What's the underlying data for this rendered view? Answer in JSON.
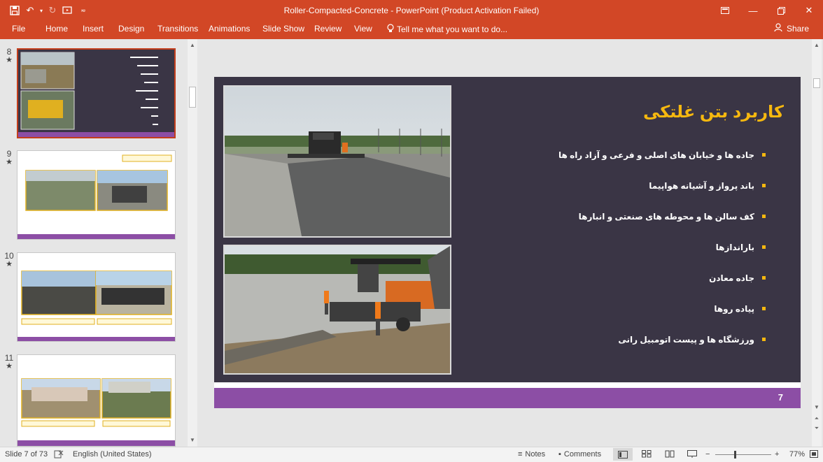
{
  "window": {
    "title": "Roller-Compacted-Concrete - PowerPoint (Product Activation Failed)"
  },
  "ribbon": {
    "tabs": [
      "File",
      "Home",
      "Insert",
      "Design",
      "Transitions",
      "Animations",
      "Slide Show",
      "Review",
      "View"
    ],
    "tell_me": "Tell me what you want to do...",
    "share": "Share"
  },
  "thumbnails": [
    {
      "number": "8",
      "star": "★"
    },
    {
      "number": "9",
      "star": "★"
    },
    {
      "number": "10",
      "star": "★"
    },
    {
      "number": "11",
      "star": "★"
    }
  ],
  "slide": {
    "title": "کاربرد بتن غلتکی",
    "bullets": [
      "جاده ها و خیابان های اصلی و فرعی و آزاد راه ها",
      "باند پرواز و آشیانه هواپیما",
      "کف سالن ها و محوطه های صنعتی و انبارها",
      "باراندازها",
      "جاده معادن",
      "پیاده روها",
      "ورزشگاه ها و پیست اتومبیل رانی"
    ],
    "number": "7",
    "colors": {
      "background": "#3a3545",
      "title": "#f6b80f",
      "footer": "#8c4ea5"
    }
  },
  "status": {
    "slide_indicator": "Slide 7 of 73",
    "language": "English (United States)",
    "notes": "Notes",
    "comments": "Comments",
    "zoom": "77%"
  },
  "colors": {
    "accent": "#d24726"
  }
}
